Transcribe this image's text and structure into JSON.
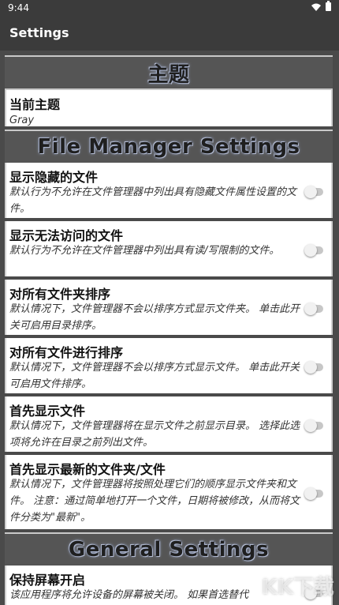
{
  "statusbar": {
    "time": "9:44",
    "icons": [
      "wifi-icon",
      "battery-icon"
    ]
  },
  "appbar": {
    "title": "Settings"
  },
  "sections": {
    "theme": {
      "header": "主题",
      "items": [
        {
          "title": "当前主题",
          "summary": "Gray"
        }
      ]
    },
    "file_manager": {
      "header": "File Manager Settings",
      "items": [
        {
          "title": "显示隐藏的文件",
          "summary": "默认行为不允许在文件管理器中列出具有隐藏文件属性设置的文件。"
        },
        {
          "title": "显示无法访问的文件",
          "summary": "默认行为不允许在文件管理器中列出具有读/写限制的文件。"
        },
        {
          "title": "对所有文件夹排序",
          "summary": "默认情况下，文件管理器不会以排序方式显示文件夹。 单击此开关可启用目录排序。"
        },
        {
          "title": "对所有文件进行排序",
          "summary": "默认情况下，文件管理器不会以排序方式显示文件。 单击此开关可启用文件排序。"
        },
        {
          "title": "首先显示文件",
          "summary": "默认情况下，文件管理器将在显示文件之前显示目录。 选择此选项将允许在目录之前列出文件。"
        },
        {
          "title": "首先显示最新的文件夹/文件",
          "summary": "默认情况下，文件管理器将按照处理它们的顺序显示文件夹和文件。 注意：通过简单地打开一个文件，日期将被修改，从而将文件分类为\"最新\"。"
        }
      ]
    },
    "general": {
      "header": "General Settings",
      "items": [
        {
          "title": "保持屏幕开启",
          "summary": "该应用程序将允许设备的屏幕被关闭。 如果首选替代"
        }
      ]
    }
  },
  "watermark": "KK下载",
  "colors": {
    "background": "#3a3a3a",
    "card": "#ffffff",
    "header_bg": "#555555"
  }
}
